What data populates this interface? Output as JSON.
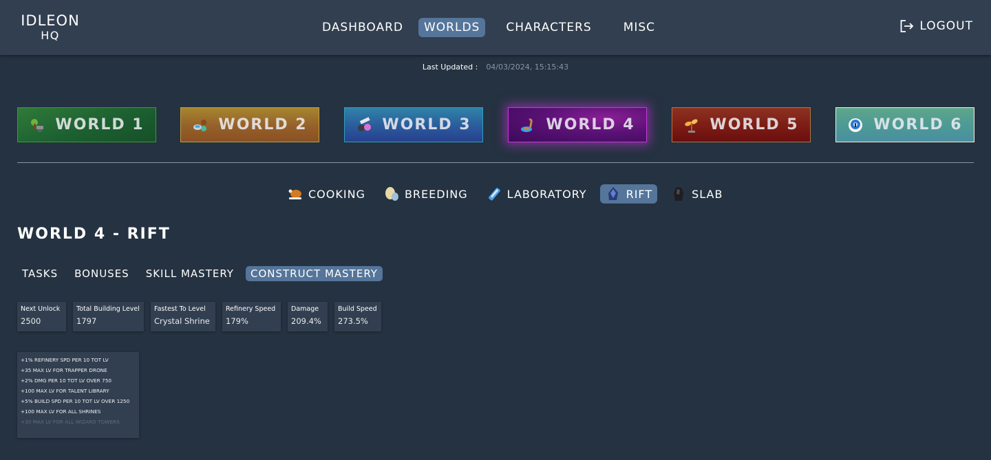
{
  "header": {
    "logo_line1": "IDLEON",
    "logo_line2": "HQ",
    "nav": [
      {
        "label": "DASHBOARD",
        "active": false
      },
      {
        "label": "WORLDS",
        "active": true
      },
      {
        "label": "CHARACTERS",
        "active": false
      },
      {
        "label": "MISC",
        "active": false
      }
    ],
    "logout_label": "LOGOUT",
    "logout_icon": "logout-icon"
  },
  "last_updated": {
    "label": "Last Updated :",
    "value": "04/03/2024, 15:15:43"
  },
  "worlds": [
    {
      "label": "WORLD 1",
      "icon": "anvil-tree-icon",
      "active": false,
      "color": "#1c6030"
    },
    {
      "label": "WORLD 2",
      "icon": "alchemy-icon",
      "active": false,
      "color": "#95602a"
    },
    {
      "label": "WORLD 3",
      "icon": "construction-icon",
      "active": false,
      "color": "#2a5b9b"
    },
    {
      "label": "WORLD 4",
      "icon": "cooking-pot-icon",
      "active": true,
      "color": "#5a1175"
    },
    {
      "label": "WORLD 5",
      "icon": "sprout-icon",
      "active": false,
      "color": "#7c1c14"
    },
    {
      "label": "WORLD 6",
      "icon": "eye-orb-icon",
      "active": false,
      "color": "#4c9a96"
    }
  ],
  "subnav": [
    {
      "label": "COOKING",
      "icon": "roast-chicken-icon",
      "active": false
    },
    {
      "label": "BREEDING",
      "icon": "eggs-icon",
      "active": false
    },
    {
      "label": "LABORATORY",
      "icon": "vial-icon",
      "active": false
    },
    {
      "label": "RIFT",
      "icon": "rift-crystal-icon",
      "active": true
    },
    {
      "label": "SLAB",
      "icon": "slab-stone-icon",
      "active": false
    }
  ],
  "page_title": "WORLD 4 - RIFT",
  "tabs": [
    {
      "label": "TASKS",
      "active": false
    },
    {
      "label": "BONUSES",
      "active": false
    },
    {
      "label": "SKILL MASTERY",
      "active": false
    },
    {
      "label": "CONSTRUCT MASTERY",
      "active": true
    }
  ],
  "stats": [
    {
      "title": "Next Unlock",
      "value": "2500"
    },
    {
      "title": "Total Building Level",
      "value": "1797"
    },
    {
      "title": "Fastest To Level",
      "value": "Crystal Shrine"
    },
    {
      "title": "Refinery Speed",
      "value": "179%"
    },
    {
      "title": "Damage",
      "value": "209.4%"
    },
    {
      "title": "Build Speed",
      "value": "273.5%"
    }
  ],
  "bonuses": [
    {
      "text": "+1% REFINERY SPD PER 10 TOT LV",
      "unlocked": true
    },
    {
      "text": "+35 MAX LV FOR TRAPPER DRONE",
      "unlocked": true
    },
    {
      "text": "+2% DMG PER 10 TOT LV OVER 750",
      "unlocked": true
    },
    {
      "text": "+100 MAX LV FOR TALENT LIBRARY",
      "unlocked": true
    },
    {
      "text": "+5% BUILD SPD PER 10 TOT LV OVER 1250",
      "unlocked": true
    },
    {
      "text": "+100 MAX LV FOR ALL SHRINES",
      "unlocked": true
    },
    {
      "text": "+30 MAX LV FOR ALL WIZARD TOWERS",
      "unlocked": false
    }
  ]
}
